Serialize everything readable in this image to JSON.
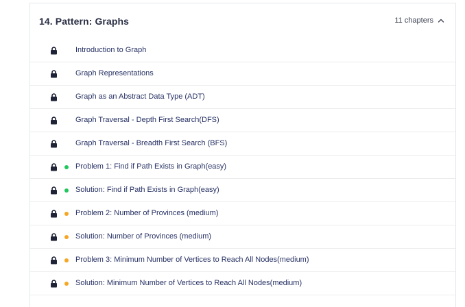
{
  "section": {
    "title": "14.  Pattern: Graphs",
    "chapters_count": "11 chapters",
    "expanded_icon": "chevron-up-icon"
  },
  "colors": {
    "easy": "#22c55e",
    "medium": "#f5a623",
    "lock": "#1f2337",
    "label": "#273164"
  },
  "chapters": [
    {
      "label": "Introduction to Graph",
      "locked": true,
      "difficulty": null
    },
    {
      "label": "Graph Representations",
      "locked": true,
      "difficulty": null
    },
    {
      "label": "Graph as an Abstract Data Type (ADT)",
      "locked": true,
      "difficulty": null
    },
    {
      "label": "Graph Traversal - Depth First Search(DFS)",
      "locked": true,
      "difficulty": null
    },
    {
      "label": "Graph Traversal - Breadth First Search (BFS)",
      "locked": true,
      "difficulty": null
    },
    {
      "label": "Problem 1: Find if Path Exists in Graph(easy)",
      "locked": true,
      "difficulty": "easy"
    },
    {
      "label": "Solution: Find if Path Exists in Graph(easy)",
      "locked": true,
      "difficulty": "easy"
    },
    {
      "label": "Problem 2: Number of Provinces (medium)",
      "locked": true,
      "difficulty": "medium"
    },
    {
      "label": "Solution: Number of Provinces (medium)",
      "locked": true,
      "difficulty": "medium"
    },
    {
      "label": "Problem 3: Minimum Number of Vertices to Reach All Nodes(medium)",
      "locked": true,
      "difficulty": "medium"
    },
    {
      "label": "Solution: Minimum Number of Vertices to Reach All Nodes(medium)",
      "locked": true,
      "difficulty": "medium"
    }
  ]
}
